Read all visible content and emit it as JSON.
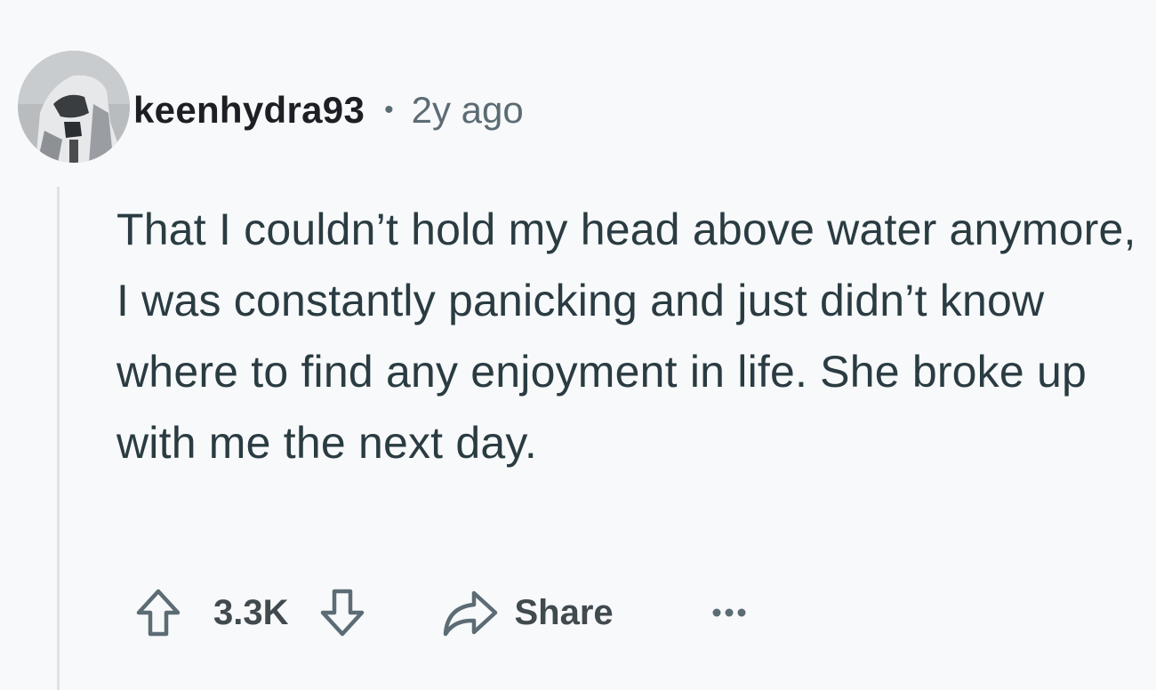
{
  "comment": {
    "author": "keenhydra93",
    "separator": "•",
    "time_ago": "2y ago",
    "body": "That I couldn’t hold my head above water anymore, I was constantly panicking and just didn’t know where to find any enjoyment in life. She broke up with me the next day.",
    "score": "3.3K",
    "share_label": "Share",
    "avatar_icon": "stormtrooper-avatar-icon"
  },
  "colors": {
    "background": "#f8f9fb",
    "text_primary": "#1c1f23",
    "text_secondary": "#5c6c74",
    "action_text": "#414a4f",
    "thread_line": "#dde2e7"
  }
}
